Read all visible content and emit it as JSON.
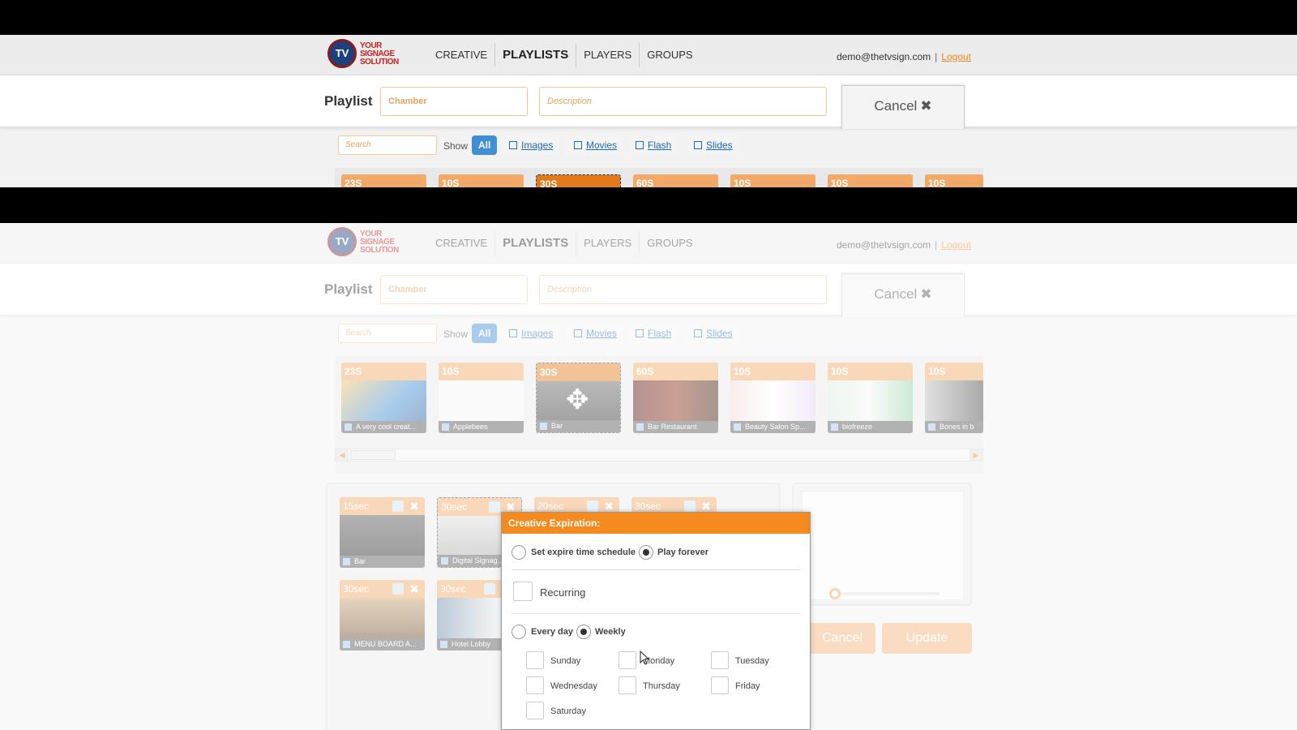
{
  "header": {
    "logo_mark": "TV",
    "logo_lines": [
      "YOUR",
      "SIGNAGE",
      "SOLUTION"
    ],
    "nav": [
      "CREATIVE",
      "PLAYLISTS",
      "PLAYERS",
      "GROUPS"
    ],
    "active_nav": "PLAYLISTS",
    "account_email": "demo@thetvsign.com",
    "separator": "|",
    "logout_label": "Logout"
  },
  "playlist_bar": {
    "label": "Playlist",
    "name_value": "Chamber",
    "description_placeholder": "Description",
    "cancel_label": "Cancel",
    "cancel_icon": "✖"
  },
  "filters": {
    "search_placeholder": "Search",
    "show_label": "Show",
    "buttons": [
      "All",
      "Images",
      "Movies",
      "Flash",
      "Slides"
    ],
    "active": "All"
  },
  "library": [
    {
      "duration": "23S",
      "caption": "A very cool creat..."
    },
    {
      "duration": "10S",
      "caption": "Applebees"
    },
    {
      "duration": "30S",
      "caption": "Bar"
    },
    {
      "duration": "60S",
      "caption": "Bar Restaurant"
    },
    {
      "duration": "10S",
      "caption": "Beauty Salon Sp..."
    },
    {
      "duration": "10S",
      "caption": "biofreeze"
    },
    {
      "duration": "10S",
      "caption": "Bones in b"
    }
  ],
  "library_top_peek": [
    "23S",
    "10S",
    "30S",
    "60S",
    "10S",
    "10S",
    "10S"
  ],
  "timeline": [
    {
      "duration": "15sec",
      "caption": "Bar"
    },
    {
      "duration": "30sec",
      "caption": "Digital Signag..."
    },
    {
      "duration": "20sec",
      "caption": ""
    },
    {
      "duration": "30sec",
      "caption": ""
    },
    {
      "duration": "30sec",
      "caption": "MENU BOARD A..."
    },
    {
      "duration": "30sec",
      "caption": "Hotel Lobby"
    }
  ],
  "timeline_remove_icon": "✖",
  "actions": {
    "cancel": "Cancel",
    "update": "Update"
  },
  "dialog": {
    "title": "Creative Expiration:",
    "mode_options": [
      "Set expire time schedule",
      "Play forever"
    ],
    "mode_selected": "Play forever",
    "recurring_label": "Recurring",
    "recurring_checked": false,
    "frequency_options": [
      "Every day",
      "Weekly"
    ],
    "frequency_selected": "Weekly",
    "days": [
      "Sunday",
      "Monday",
      "Tuesday",
      "Wednesday",
      "Thursday",
      "Friday",
      "Saturday"
    ]
  },
  "colors": {
    "accent": "#f58a1f",
    "link": "#1c6ab8",
    "active_filter": "#3f8ed6",
    "logo_red": "#c8211f",
    "logo_blue": "#1d3f7c"
  }
}
